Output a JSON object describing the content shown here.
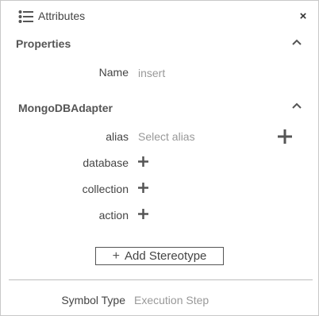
{
  "header": {
    "title": "Attributes",
    "list_icon": "list-icon",
    "close_icon": "close-icon",
    "close_glyph": "×"
  },
  "properties": {
    "section_title": "Properties",
    "name_label": "Name",
    "name_value": "insert"
  },
  "adapter": {
    "section_title": "MongoDBAdapter",
    "alias_label": "alias",
    "alias_placeholder": "Select alias",
    "fields": [
      "database",
      "collection",
      "action"
    ]
  },
  "add_stereotype": {
    "plus": "+",
    "label": "Add Stereotype"
  },
  "footer": {
    "symbol_type_label": "Symbol Type",
    "symbol_type_value": "Execution Step"
  },
  "colors": {
    "icon": "#555555",
    "border": "#c8c8c8",
    "muted_text": "#999999"
  }
}
